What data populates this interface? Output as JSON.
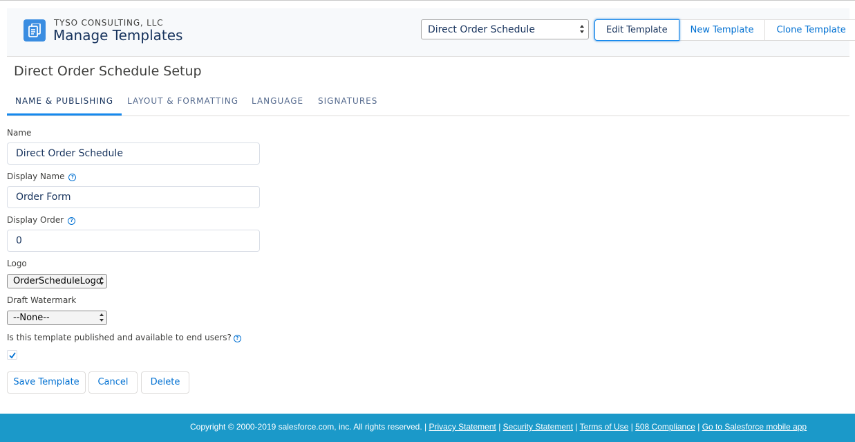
{
  "header": {
    "company": "TYSO CONSULTING, LLC",
    "title": "Manage Templates",
    "template_select": "Direct Order Schedule",
    "buttons": {
      "edit": "Edit Template",
      "new": "New Template",
      "clone": "Clone Template"
    },
    "icon": "document-stack-icon",
    "accent_color": "#3a8de1"
  },
  "setup_title": "Direct Order Schedule Setup",
  "tabs": [
    {
      "label": "NAME & PUBLISHING",
      "active": true
    },
    {
      "label": "LAYOUT & FORMATTING",
      "active": false
    },
    {
      "label": "LANGUAGE",
      "active": false
    },
    {
      "label": "SIGNATURES",
      "active": false
    }
  ],
  "form": {
    "name_label": "Name",
    "name_value": "Direct Order Schedule",
    "display_name_label": "Display Name",
    "display_name_value": "Order Form",
    "display_order_label": "Display Order",
    "display_order_value": "0",
    "logo_label": "Logo",
    "logo_value": "OrderScheduleLogo",
    "watermark_label": "Draft Watermark",
    "watermark_value": "--None--",
    "published_label": "Is this template published and available to end users?",
    "published_checked": true,
    "help_icon": "?"
  },
  "actions": {
    "save": "Save Template",
    "cancel": "Cancel",
    "delete": "Delete"
  },
  "footer": {
    "copyright": "Copyright © 2000-2019 salesforce.com, inc. All rights reserved.",
    "links": {
      "privacy": "Privacy Statement",
      "security": "Security Statement",
      "terms": "Terms of Use",
      "compliance": "508 Compliance",
      "mobile": "Go to Salesforce mobile app"
    },
    "separator": "|",
    "background_color": "#1b99c9"
  }
}
